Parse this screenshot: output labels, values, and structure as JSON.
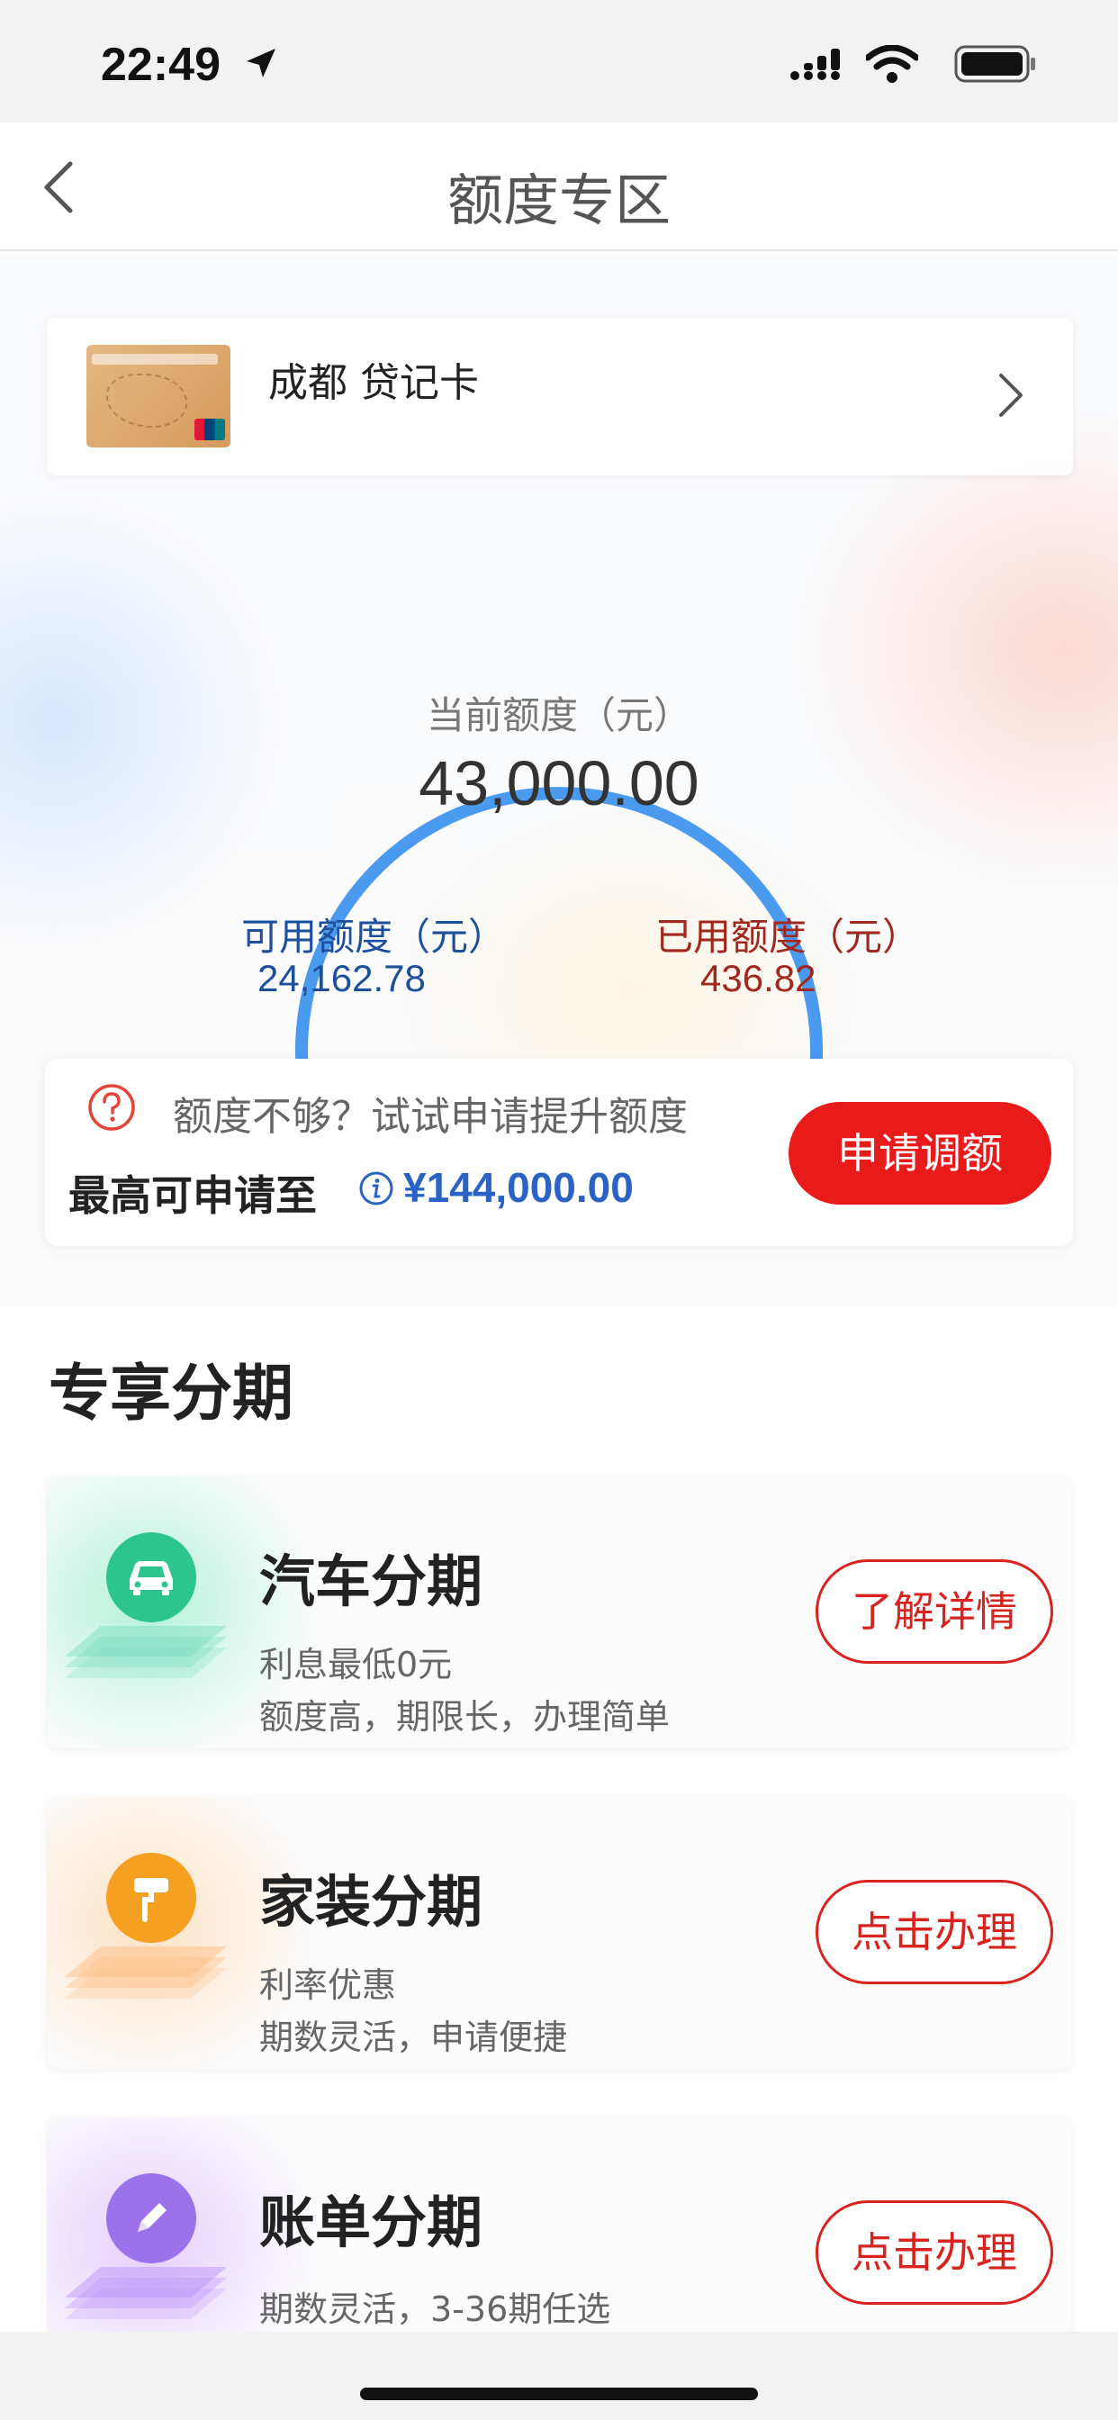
{
  "status_bar": {
    "time": "22:49"
  },
  "nav": {
    "title": "额度专区"
  },
  "card": {
    "name": "成都 贷记卡"
  },
  "gauge": {
    "label": "当前额度（元）",
    "total": "43,000.00",
    "available_label": "可用额度（元）",
    "available_value": "24,162.78",
    "used_label": "已用额度（元）",
    "used_value": "436.82",
    "used_fraction": 0.0102,
    "colors": {
      "arc": "#4a9af0",
      "used": "#f2642c"
    }
  },
  "increase": {
    "hint": "额度不够？试试申请提升额度",
    "max_label": "最高可申请至",
    "max_value": "¥144,000.00",
    "apply_label": "申请调额"
  },
  "section": {
    "title": "专享分期"
  },
  "installments": [
    {
      "title": "汽车分期",
      "line1": "利息最低0元",
      "line2": "额度高，期限长，办理简单",
      "button": "了解详情",
      "icon": "car-icon",
      "color": "#2dc58e"
    },
    {
      "title": "家装分期",
      "line1": "利率优惠",
      "line2": "期数灵活，申请便捷",
      "button": "点击办理",
      "icon": "paint-roller-icon",
      "color": "#f5a020"
    },
    {
      "title": "账单分期",
      "line1": "期数灵活，3-36期任选",
      "line2": "",
      "button": "点击办理",
      "icon": "pencil-icon",
      "color": "#9b72ea"
    }
  ]
}
